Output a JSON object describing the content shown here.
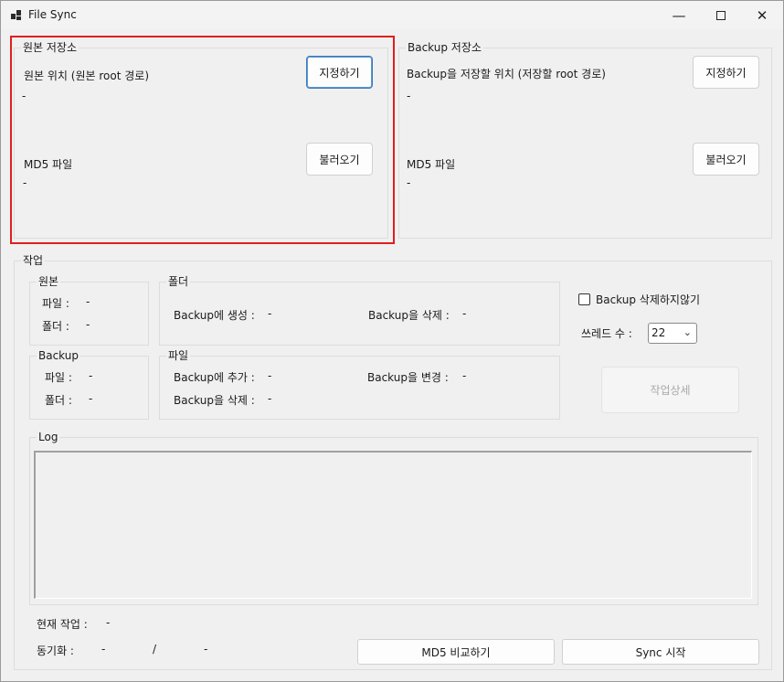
{
  "window": {
    "title": "File Sync",
    "minimize_icon": "minimize-icon",
    "maximize_icon": "maximize-icon",
    "close_icon": "close-icon"
  },
  "source": {
    "group_title": "원본 저장소",
    "location_label": "원본 위치 (원본 root 경로)",
    "location_value": "-",
    "set_button": "지정하기",
    "md5_label": "MD5 파일",
    "md5_value": "-",
    "load_button": "불러오기"
  },
  "backup": {
    "group_title": "Backup 저장소",
    "location_label": "Backup을 저장할 위치 (저장할 root 경로)",
    "location_value": "-",
    "set_button": "지정하기",
    "md5_label": "MD5 파일",
    "md5_value": "-",
    "load_button": "불러오기"
  },
  "task": {
    "group_title": "작업",
    "source_stats": {
      "title": "원본",
      "file_label": "파일 :",
      "file_value": "-",
      "folder_label": "폴더 :",
      "folder_value": "-"
    },
    "backup_stats": {
      "title": "Backup",
      "file_label": "파일 :",
      "file_value": "-",
      "folder_label": "폴더 :",
      "folder_value": "-"
    },
    "folder_ops": {
      "title": "폴더",
      "create_label": "Backup에 생성 :",
      "create_value": "-",
      "delete_label": "Backup을 삭제 :",
      "delete_value": "-"
    },
    "file_ops": {
      "title": "파일",
      "add_label": "Backup에 추가 :",
      "add_value": "-",
      "change_label": "Backup을 변경 :",
      "change_value": "-",
      "delete_label": "Backup을 삭제 :",
      "delete_value": "-"
    },
    "no_delete_checkbox_label": "Backup 삭제하지않기",
    "no_delete_checked": false,
    "threads_label": "쓰레드 수 :",
    "threads_value": "22",
    "detail_button": "작업상세",
    "log_title": "Log",
    "current_task_label": "현재 작업 :",
    "current_task_value": "-",
    "sync_label": "동기화 :",
    "sync_done": "-",
    "sync_sep": "/",
    "sync_total": "-",
    "md5_compare_button": "MD5 비교하기",
    "sync_start_button": "Sync 시작"
  }
}
